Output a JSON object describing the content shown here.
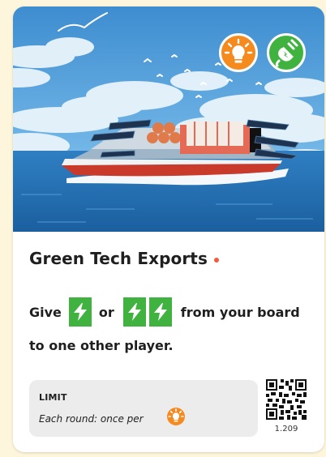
{
  "card": {
    "title": "Green Tech Exports",
    "line1": {
      "before": "Give",
      "middle": "or",
      "after": "from your board"
    },
    "line2": "to one other player.",
    "limit_label": "LIMIT",
    "limit_text": "Each round: once per",
    "code": "1.209"
  },
  "icons": {
    "badge_left": "lightbulb-icon",
    "badge_right": "plug-icon",
    "energy": "lightning-bolt-icon"
  },
  "colors": {
    "page_background": "#fdf6dc",
    "bulb_orange": "#f58a1f",
    "energy_green": "#3fb23f",
    "accent_dot": "#f15a3c",
    "limit_background": "#ececec"
  }
}
